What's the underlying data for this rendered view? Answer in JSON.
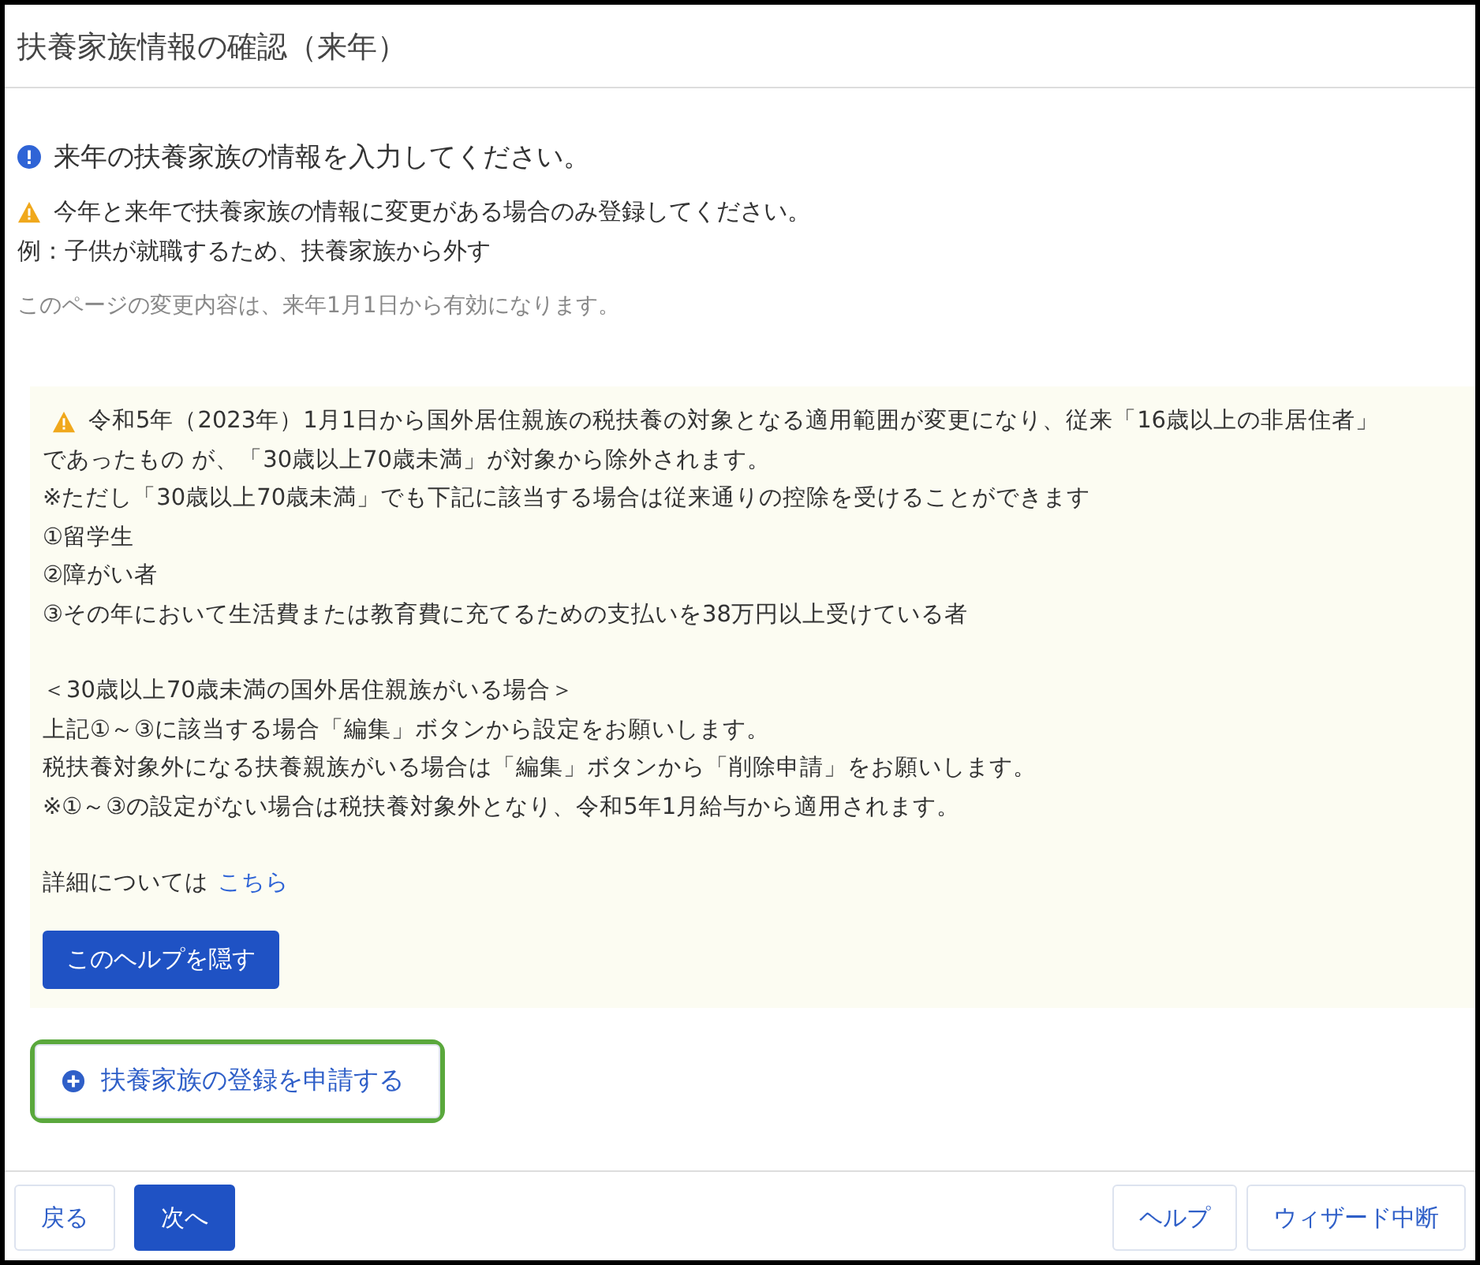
{
  "window": {
    "title": "扶養家族情報の確認（来年）"
  },
  "messages": [
    {
      "kind": "info",
      "text": "来年の扶養家族の情報を入力してください。"
    },
    {
      "kind": "warning",
      "text": "今年と来年で扶養家族の情報に変更がある場合のみ登録してください。"
    },
    {
      "kind": "plain",
      "text": "例：子供が就職するため、扶養家族から外す"
    },
    {
      "kind": "note",
      "text": "このページの変更内容は、来年1月1日から有効になります。"
    }
  ],
  "help": {
    "blocks": [
      {
        "kind": "warning",
        "lines": [
          "令和5年（2023年）1月1日から国外居住親族の税扶養の対象となる適用範囲が変更になり、従来「16歳以上の非居住者」",
          "であったもの が、「30歳以上70歳未満」が対象から除外されます。",
          "※ただし「30歳以上70歳未満」でも下記に該当する場合は従来通りの控除を受けることができます",
          "①留学生",
          "②障がい者",
          "③その年において生活費または教育費に充てるための支払いを38万円以上受けている者"
        ]
      },
      {
        "lines": [
          "＜30歳以上70歳未満の国外居住親族がいる場合＞",
          "上記①～③に該当する場合「編集」ボタンから設定をお願いします。",
          "税扶養対象外になる扶養親族がいる場合は「編集」ボタンから「削除申請」をお願いします。",
          "※①～③の設定がない場合は税扶養対象外となり、令和5年1月給与から適用されます。"
        ]
      }
    ],
    "details_text": "詳細については",
    "details_link": "こちら",
    "hide_button": "このヘルプを隠す"
  },
  "add_button": {
    "label": "扶養家族の登録を申請する",
    "highlighted": true
  },
  "footer": {
    "left": [
      {
        "label": "戻る",
        "primary": false
      },
      {
        "label": "次へ",
        "primary": true
      }
    ],
    "right": [
      {
        "label": "ヘルプ",
        "primary": false
      },
      {
        "label": "ウィザード中断",
        "primary": false
      }
    ]
  }
}
